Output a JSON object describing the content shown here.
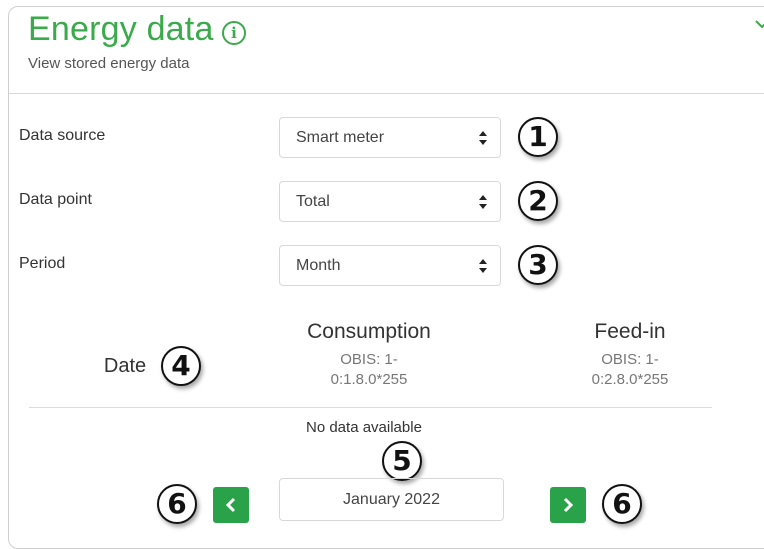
{
  "header": {
    "title": "Energy data",
    "subtitle": "View stored energy data",
    "info_icon": "info-icon",
    "collapse_icon": "chevron-down-icon"
  },
  "form": {
    "data_source": {
      "label": "Data source",
      "value": "Smart meter"
    },
    "data_point": {
      "label": "Data point",
      "value": "Total"
    },
    "period": {
      "label": "Period",
      "value": "Month"
    }
  },
  "table": {
    "date_header": "Date",
    "consumption_header": "Consumption",
    "consumption_obis_1": "OBIS: 1-",
    "consumption_obis_2": "0:1.8.0*255",
    "feedin_header": "Feed-in",
    "feedin_obis_1": "OBIS: 1-",
    "feedin_obis_2": "0:2.8.0*255",
    "empty_message": "No data available"
  },
  "pager": {
    "current_period": "January 2022",
    "prev_icon": "chevron-left-icon",
    "next_icon": "chevron-right-icon"
  },
  "callouts": {
    "c1": "1",
    "c2": "2",
    "c3": "3",
    "c4": "4",
    "c5": "5",
    "c6a": "6",
    "c6b": "6"
  },
  "colors": {
    "accent": "#3aaa4a",
    "button": "#2aa24a"
  }
}
